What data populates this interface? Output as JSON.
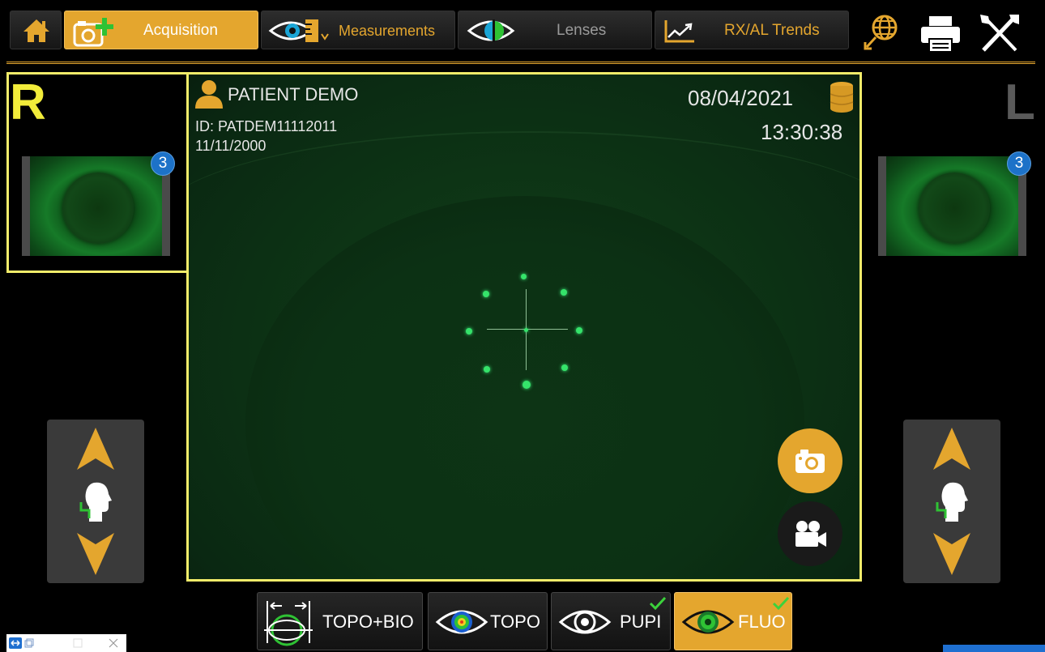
{
  "toolbar": {
    "tabs": [
      {
        "label": "Acquisition",
        "active": true
      },
      {
        "label": "Measurements",
        "active": false
      },
      {
        "label": "Lenses",
        "active": false
      },
      {
        "label": "RX/AL Trends",
        "active": false
      }
    ],
    "icons": [
      "home-icon",
      "add-camera-icon",
      "eye-measure-icon",
      "lens-eye-icon",
      "trend-chart-icon",
      "globe-icon",
      "printer-icon",
      "tools-icon"
    ]
  },
  "eyes": {
    "right_label": "R",
    "left_label": "L",
    "right_count": "3",
    "left_count": "3"
  },
  "patient": {
    "name": "PATIENT DEMO",
    "id": "ID: PATDEM11112011",
    "dob": "11/11/2000",
    "date": "08/04/2021",
    "time": "13:30:38"
  },
  "modes": [
    {
      "label": "TOPO+BIO",
      "active": false,
      "checked": false
    },
    {
      "label": "TOPO",
      "active": false,
      "checked": false
    },
    {
      "label": "PUPI",
      "active": false,
      "checked": true
    },
    {
      "label": "FLUO",
      "active": true,
      "checked": true
    }
  ],
  "colors": {
    "accent": "#e4a62e",
    "frame": "#f2ec6a",
    "badge": "#1d72c8",
    "target": "#35e36a",
    "check": "#3cd23c"
  }
}
